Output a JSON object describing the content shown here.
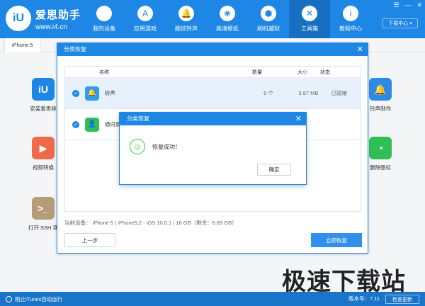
{
  "header": {
    "brand_name": "爱思助手",
    "brand_url": "www.i4.cn",
    "logo_text": "iU",
    "nav": [
      {
        "label": "我的设备",
        "icon": ""
      },
      {
        "label": "应用游戏",
        "icon": "A"
      },
      {
        "label": "酷炫铃声",
        "icon": "🔔"
      },
      {
        "label": "高清壁纸",
        "icon": "❀"
      },
      {
        "label": "刷机越狱",
        "icon": "⬢"
      },
      {
        "label": "工具箱",
        "icon": "✕"
      },
      {
        "label": "教程中心",
        "icon": "i"
      }
    ],
    "window_controls": [
      "☰",
      "—",
      "✕"
    ],
    "download_center": "下载中心",
    "download_arrow": "▾"
  },
  "device_tab": "iPhone 5",
  "bg_tools": [
    {
      "label": "安装爱思移",
      "icon": "iU",
      "color": "#1e87e6"
    },
    {
      "label": "视频转换",
      "icon": "▶",
      "color": "#ee6a4a"
    },
    {
      "label": "打开 SSH 通",
      "icon": ">_",
      "color": "#b59b78"
    },
    {
      "label": "铃声制作",
      "icon": "🔔",
      "color": "#2d8ae6"
    },
    {
      "label": "删除图标",
      "icon": "◔",
      "color": "#2fbf56"
    }
  ],
  "dialog": {
    "title": "分类恢复",
    "close": "✕",
    "columns": {
      "name": "名称",
      "count": "数量",
      "size": "大小",
      "status": "状态"
    },
    "rows": [
      {
        "check": "✓",
        "icon": "🔔",
        "icon_color": "#2d9cf0",
        "name": "铃声",
        "count": "6 个",
        "size": "3.97 MB",
        "status": "已就绪"
      },
      {
        "check": "✓",
        "icon": "👤",
        "icon_color": "#2fbf56",
        "name": "通讯录",
        "count": "",
        "size": "",
        "status": ""
      }
    ],
    "device_info": "当前设备： iPhone 5  |  iPhone5,2 - iOS 10.0.1  |  16 GB（剩余：8.83 GB）",
    "prev_button": "上一步",
    "restore_button": "立即恢复"
  },
  "popup": {
    "title": "分类恢复",
    "close": "✕",
    "icon": "☺",
    "message": "恢复成功！",
    "ok_button": "确定"
  },
  "watermark": "极速下载站",
  "statusbar": {
    "itunes_toggle": "阻止iTunes自动运行",
    "version": "版本号：7.11",
    "check_update": "检查更新"
  },
  "colors": {
    "brand": "#1e87e6",
    "row_selected": "#e7f1fb",
    "success": "#2ecc40"
  }
}
